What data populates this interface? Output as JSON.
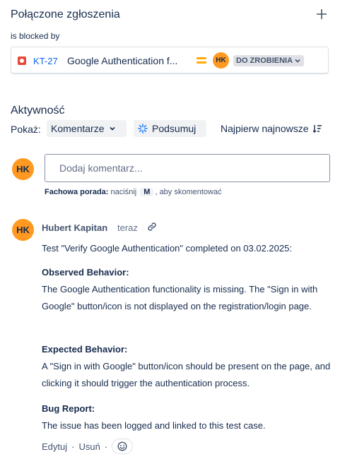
{
  "linked_issues": {
    "title": "Połączone zgłoszenia",
    "relation": "is blocked by",
    "issue": {
      "key": "KT-27",
      "summary": "Google Authentication f...",
      "assignee_initials": "HK",
      "status": "DO ZROBIENIA",
      "priority_color": "#ffab00",
      "type_color": "#e5493a"
    }
  },
  "activity": {
    "title": "Aktywność",
    "show_label": "Pokaż:",
    "filter_value": "Komentarze",
    "summarize_label": "Podsumuj",
    "sort_label": "Najpierw najnowsze"
  },
  "comment_box": {
    "avatar_initials": "HK",
    "placeholder": "Dodaj komentarz...",
    "tip_prefix": "Fachowa porada:",
    "tip_mid": "naciśnij",
    "tip_key": "M",
    "tip_suffix": ", aby skomentować"
  },
  "comment": {
    "avatar_initials": "HK",
    "author": "Hubert Kapitan",
    "time": "teraz",
    "intro": "Test \"Verify Google Authentication\" completed on 03.02.2025:",
    "observed_heading": "Observed Behavior:",
    "observed_text": "The Google Authentication functionality is missing. The \"Sign in with Google\" button/icon is not displayed on the registration/login page.",
    "expected_heading": "Expected Behavior:",
    "expected_text": "A \"Sign in with Google\" button/icon should be present on the page, and clicking it should trigger the authentication process.",
    "bug_heading": "Bug Report:",
    "bug_text": "The issue has been logged and linked to this test case.",
    "edit_label": "Edytuj",
    "delete_label": "Usuń",
    "separator": "·"
  },
  "colors": {
    "avatar_bg": "#ff991f",
    "link": "#0c66e4",
    "text": "#172b4d"
  }
}
